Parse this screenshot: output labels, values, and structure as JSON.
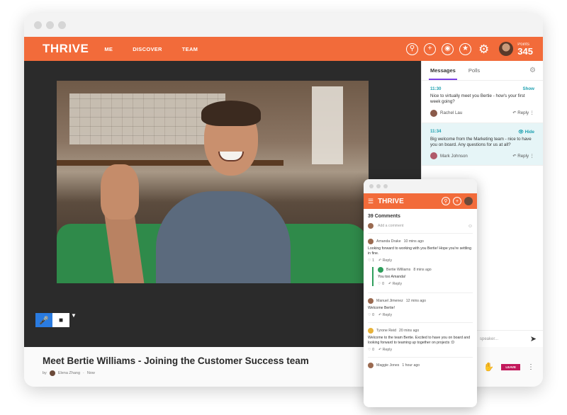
{
  "app": {
    "logo": "THRIVE",
    "nav": [
      "ME",
      "DISCOVER",
      "TEAM"
    ],
    "header_icons": [
      "search-icon",
      "add-icon",
      "notification-icon",
      "award-icon",
      "gear-icon"
    ],
    "points_label": "Points",
    "points_value": "345",
    "brand_color": "#f26b3a"
  },
  "video": {
    "title": "Meet Bertie Williams - Joining the Customer Success team",
    "by_prefix": "by",
    "author": "Elena Zhang",
    "when": "Now"
  },
  "side_panel": {
    "tabs": [
      "Messages",
      "Polls"
    ],
    "messages": [
      {
        "time": "11:30",
        "toggle": "Show",
        "text": "Nice to virtually meet you Bertie - how's your first week going?",
        "author": "Rachel Lau",
        "reply": "Reply"
      },
      {
        "time": "11:34",
        "toggle": "Hide",
        "text": "Big welcome from the Marketing team - nice to have you on board. Any questions for us at all?",
        "author": "Mark Johnson",
        "reply": "Reply"
      }
    ],
    "speaker_placeholder": "speaker...",
    "badge_label": "LEAVE"
  },
  "mobile": {
    "logo": "THRIVE",
    "comments_count": "39 Comments",
    "add_placeholder": "Add a comment",
    "comments": [
      {
        "author": "Amanda Drake",
        "time": "10 mins ago",
        "text": "Looking forward to working with you Bertie! Hope you're settling in fine.",
        "likes": "1",
        "reply": "Reply",
        "nested": {
          "author": "Bertie Williams",
          "time": "8 mins ago",
          "text": "You too Amanda!",
          "likes": "0",
          "reply": "Reply"
        }
      },
      {
        "author": "Manuel Jimenez",
        "time": "12 mins ago",
        "text": "Welcome Bertie!",
        "likes": "0",
        "reply": "Reply"
      },
      {
        "author": "Tyrone Reid",
        "time": "20 mins ago",
        "text": "Welcome to the team Bertie. Excited to have you on board and looking forward to teaming up together on projects :D",
        "likes": "0",
        "reply": "Reply"
      }
    ],
    "last_comment_author": "Maggie Jones",
    "last_comment_time": "1 hour ago"
  }
}
